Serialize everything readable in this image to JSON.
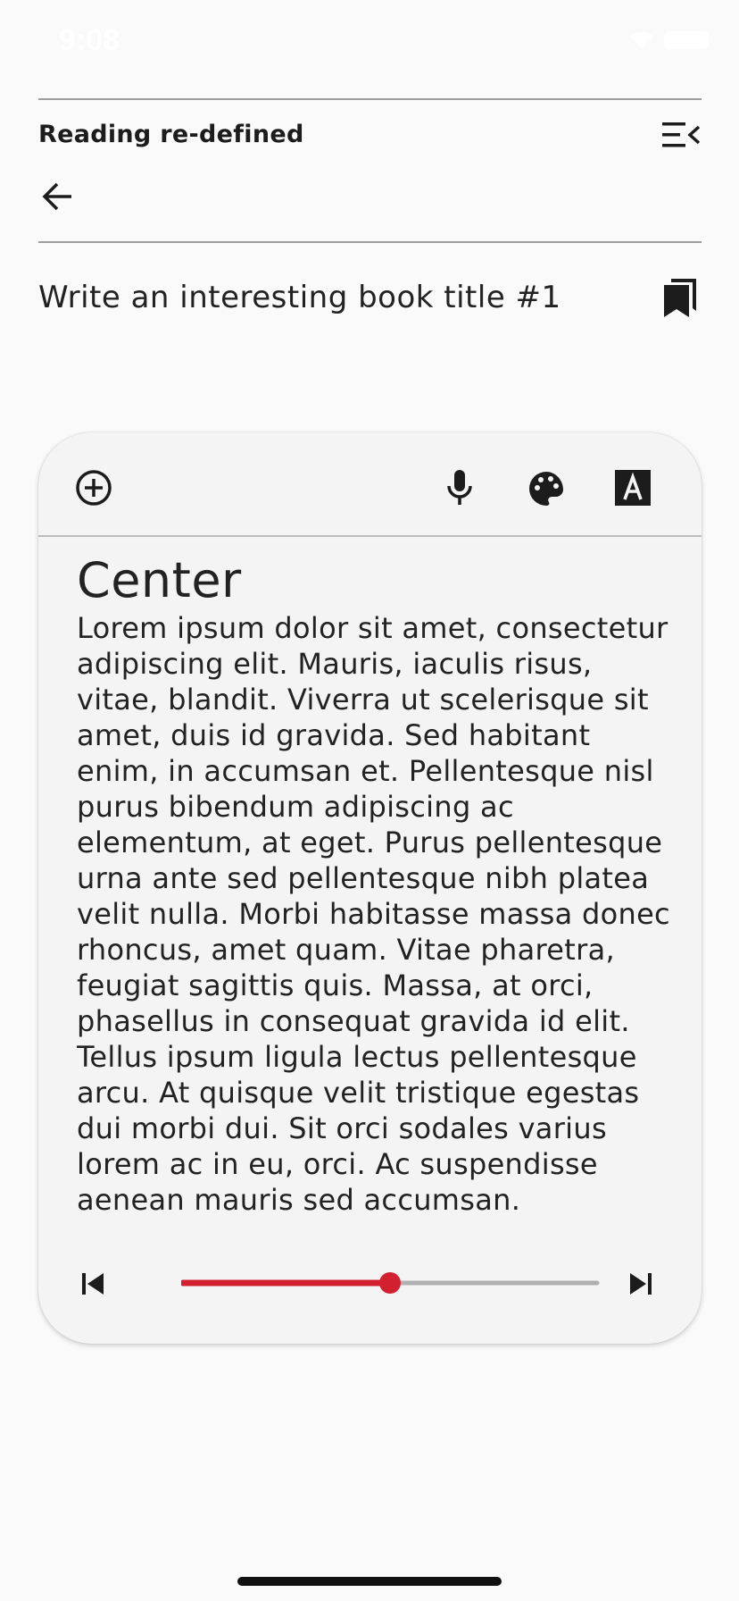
{
  "status_bar": {
    "time": "9:08"
  },
  "header": {
    "app_title": "Reading re-defined"
  },
  "book": {
    "title": "Write an interesting book title #1"
  },
  "reader": {
    "heading": "Center",
    "body": "Lorem ipsum dolor sit amet, consectetur adipiscing elit. Mauris, iaculis risus, vitae, blandit. Viverra ut scelerisque sit amet, duis id gravida. Sed habitant enim, in accumsan et. Pellentesque nisl purus bibendum adipiscing ac elementum, at eget. Purus pellentesque urna ante sed pellentesque nibh platea velit nulla. Morbi habitasse massa donec rhoncus, amet quam. Vitae pharetra, feugiat sagittis quis. Massa, at orci, phasellus in consequat gravida id elit. Tellus ipsum ligula lectus pellentesque arcu. At quisque velit tristique egestas dui morbi dui. Sit orci sodales varius lorem ac in eu, orci. Ac suspendisse aenean mauris sed accumsan."
  },
  "toolbar": {
    "icons": [
      "add-circle-icon",
      "microphone-icon",
      "palette-icon",
      "font-icon"
    ]
  },
  "player": {
    "progress": 0.5,
    "accent_color": "#d32030",
    "track_color": "#b0b0b0",
    "icons": [
      "skip-previous-icon",
      "skip-next-icon"
    ]
  }
}
